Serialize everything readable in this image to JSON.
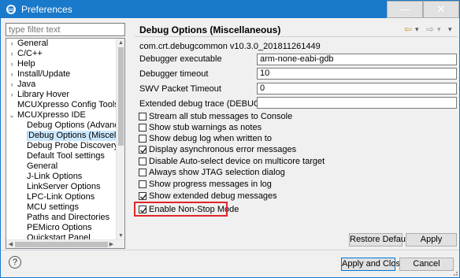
{
  "window": {
    "title": "Preferences",
    "minimize_glyph": "—",
    "close_glyph": "✕",
    "accent_color": "#1979ca"
  },
  "filter": {
    "placeholder": "type filter text"
  },
  "tree": {
    "items": [
      {
        "label": "General",
        "expander": "chevron-right-icon"
      },
      {
        "label": "C/C++",
        "expander": "chevron-right-icon"
      },
      {
        "label": "Help",
        "expander": "chevron-right-icon"
      },
      {
        "label": "Install/Update",
        "expander": "chevron-right-icon"
      },
      {
        "label": "Java",
        "expander": "chevron-right-icon"
      },
      {
        "label": "Library Hover",
        "expander": "chevron-right-icon"
      },
      {
        "label": "MCUXpresso Config Tools",
        "expander": "none"
      },
      {
        "label": "MCUXpresso IDE",
        "expander": "chevron-down-icon"
      },
      {
        "label": "Debug Options (Advanced)",
        "expander": "none"
      },
      {
        "label": "Debug Options (Miscellaneou",
        "expander": "none",
        "selected": true
      },
      {
        "label": "Debug Probe Discovery",
        "expander": "none"
      },
      {
        "label": "Default Tool settings",
        "expander": "none"
      },
      {
        "label": "General",
        "expander": "none"
      },
      {
        "label": "J-Link Options",
        "expander": "none"
      },
      {
        "label": "LinkServer Options",
        "expander": "none"
      },
      {
        "label": "LPC-Link Options",
        "expander": "none"
      },
      {
        "label": "MCU settings",
        "expander": "none"
      },
      {
        "label": "Paths and Directories",
        "expander": "none"
      },
      {
        "label": "PEMicro Options",
        "expander": "none"
      },
      {
        "label": "Quickstart Panel",
        "expander": "none"
      }
    ]
  },
  "page": {
    "title": "Debug Options (Miscellaneous)",
    "version": "com.crt.debugcommon v10.3.0_201811261449",
    "nav": {
      "back": "⇦",
      "forward": "⇨",
      "menu": "▾"
    }
  },
  "fields": [
    {
      "label": "Debugger executable",
      "value": "arm-none-eabi-gdb"
    },
    {
      "label": "Debugger timeout",
      "value": "10"
    },
    {
      "label": "SWV Packet Timeout",
      "value": "0"
    },
    {
      "label": "Extended debug trace (DEBUG_TRACE)",
      "value": ""
    }
  ],
  "checkboxes": [
    {
      "label": "Stream all stub messages to Console",
      "checked": false
    },
    {
      "label": "Show stub warnings as notes",
      "checked": false
    },
    {
      "label": "Show debug log when written to",
      "checked": false
    },
    {
      "label": "Display asynchronous error messages",
      "checked": true
    },
    {
      "label": "Disable Auto-select device on multicore target",
      "checked": false
    },
    {
      "label": "Always show JTAG selection dialog",
      "checked": false
    },
    {
      "label": "Show progress messages in log",
      "checked": false
    },
    {
      "label": "Show extended debug messages",
      "checked": true
    },
    {
      "label": "Enable Non-Stop Mode",
      "checked": true,
      "highlighted": true
    }
  ],
  "highlight_color": "#e0262b",
  "buttons": {
    "restore_defaults": "Restore Defaults",
    "apply": "Apply",
    "apply_and_close": "Apply and Close",
    "cancel": "Cancel",
    "help": "?"
  }
}
